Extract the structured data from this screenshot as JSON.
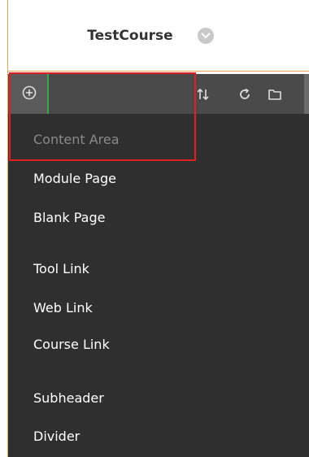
{
  "header": {
    "course_title": "TestCourse",
    "menu_icon": "chevron-down-icon"
  },
  "toolbar": {
    "add_icon": "add-circle-icon",
    "sort_icon": "sort-icon",
    "refresh_icon": "refresh-icon",
    "folder_icon": "folder-icon"
  },
  "menu": {
    "items": [
      {
        "label": "Content Area",
        "disabled": true
      },
      {
        "label": "Module Page"
      },
      {
        "label": "Blank Page"
      },
      {
        "label": "Tool Link"
      },
      {
        "label": "Web Link"
      },
      {
        "label": "Course Link"
      },
      {
        "label": "Subheader"
      },
      {
        "label": "Divider"
      }
    ]
  },
  "colors": {
    "toolbar_bg": "#4a4a4a",
    "menu_bg": "#2f2f2f",
    "highlight": "#e02020",
    "accent_green": "#3aa64a",
    "frame_border": "#e8a55a"
  }
}
